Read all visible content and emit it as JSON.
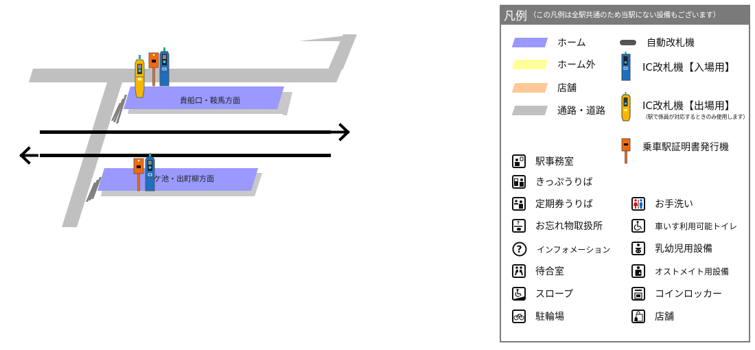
{
  "diagram": {
    "platforms": [
      {
        "label": "貴船口・鞍馬方面",
        "direction": "right"
      },
      {
        "label": "宝ケ池・出町柳方面",
        "direction": "left"
      }
    ],
    "colors": {
      "platform": "#9999ff",
      "road": "#c0c0c0",
      "platform_shadow": "#c8c8c8",
      "gate_in": "#1e6fc0",
      "gate_out": "#f5b800",
      "cert_machine": "#f06a10",
      "track": "#000000"
    }
  },
  "legend": {
    "title": "凡例",
    "subtitle": "（この凡例は全駅共通のため当駅にない設備もございます）",
    "swatches": [
      {
        "label": "ホーム",
        "color": "#9999ff"
      },
      {
        "label": "ホーム外",
        "color": "#ffff99"
      },
      {
        "label": "店舗",
        "color": "#ffc896"
      },
      {
        "label": "通路・道路",
        "color": "#c0c0c0"
      }
    ],
    "machines": [
      {
        "icon": "automatic-gate-icon",
        "label": "自動改札機"
      },
      {
        "icon": "ic-gate-entry-icon",
        "label": "IC改札機【入場用】"
      },
      {
        "icon": "ic-gate-exit-icon",
        "label": "IC改札機【出場用】",
        "note": "（駅で係員が対応するときのみ使用します）"
      },
      {
        "icon": "boarding-certificate-machine-icon",
        "label": "乗車駅証明書発行機"
      }
    ],
    "facilities_left": [
      {
        "icon": "station-office-icon",
        "label": "駅事務室"
      },
      {
        "icon": "ticket-counter-icon",
        "label": "きっぷうりば"
      },
      {
        "icon": "commuter-pass-counter-icon",
        "label": "定期券うりば"
      },
      {
        "icon": "lost-and-found-icon",
        "label": "お忘れ物取扱所"
      },
      {
        "icon": "information-icon",
        "label": "インフォメーション"
      },
      {
        "icon": "waiting-room-icon",
        "label": "待合室"
      },
      {
        "icon": "slope-icon",
        "label": "スロープ"
      },
      {
        "icon": "bicycle-parking-icon",
        "label": "駐輪場"
      }
    ],
    "facilities_right": [
      {
        "icon": "restroom-icon",
        "label": "お手洗い"
      },
      {
        "icon": "wheelchair-toilet-icon",
        "label": "車いす利用可能トイレ"
      },
      {
        "icon": "baby-facility-icon",
        "label": "乳幼児用設備"
      },
      {
        "icon": "ostomate-icon",
        "label": "オストメイト用設備"
      },
      {
        "icon": "coin-locker-icon",
        "label": "コインロッカー"
      },
      {
        "icon": "shop-icon",
        "label": "店舗"
      }
    ]
  }
}
